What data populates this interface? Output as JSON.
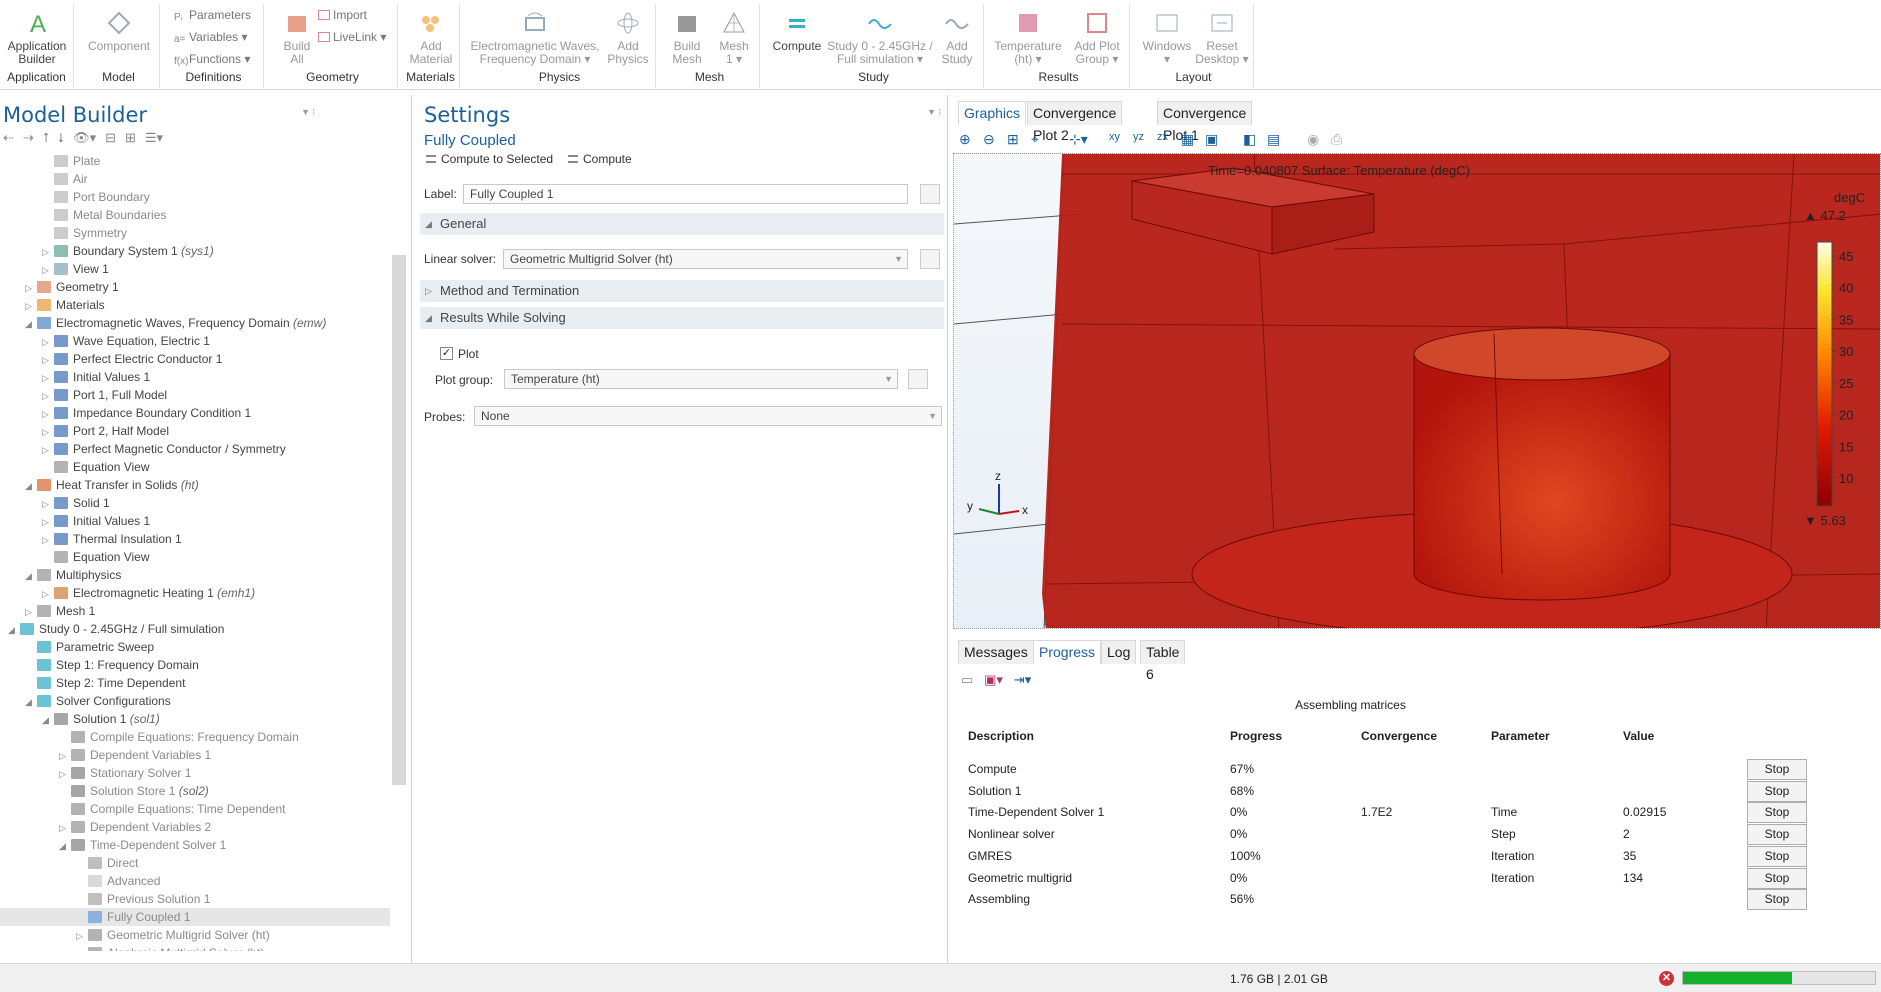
{
  "ribbon": {
    "groups": [
      {
        "label": "Application",
        "buttons": [
          {
            "label": "Application\nBuilder",
            "icon": "app-builder-icon"
          }
        ]
      },
      {
        "label": "Model",
        "buttons": [
          {
            "label": "Component",
            "icon": "component-icon"
          }
        ]
      },
      {
        "label": "Definitions",
        "small": [
          "Parameters",
          "Variables ▾",
          "Functions ▾"
        ]
      },
      {
        "label": "Geometry",
        "buttons": [
          {
            "label": "Build\nAll",
            "icon": "build-all-icon"
          }
        ],
        "small": [
          "Import",
          "LiveLink ▾"
        ]
      },
      {
        "label": "Materials",
        "buttons": [
          {
            "label": "Add\nMaterial",
            "icon": "add-material-icon"
          }
        ]
      },
      {
        "label": "Physics",
        "buttons": [
          {
            "label": "Electromagnetic Waves,\nFrequency Domain ▾",
            "icon": "emw-icon"
          },
          {
            "label": "Add\nPhysics",
            "icon": "add-physics-icon"
          }
        ]
      },
      {
        "label": "Mesh",
        "buttons": [
          {
            "label": "Build\nMesh",
            "icon": "build-mesh-icon"
          },
          {
            "label": "Mesh\n1 ▾",
            "icon": "mesh-icon"
          }
        ]
      },
      {
        "label": "Study",
        "buttons": [
          {
            "label": "Compute",
            "icon": "compute-icon"
          },
          {
            "label": "Study 0 - 2.45GHz /\nFull simulation ▾",
            "icon": "study-icon"
          },
          {
            "label": "Add\nStudy",
            "icon": "add-study-icon"
          }
        ]
      },
      {
        "label": "Results",
        "buttons": [
          {
            "label": "Temperature\n(ht) ▾",
            "icon": "temperature-plot-icon"
          },
          {
            "label": "Add Plot\nGroup ▾",
            "icon": "add-plot-group-icon"
          }
        ]
      },
      {
        "label": "Layout",
        "buttons": [
          {
            "label": "Windows\n▾",
            "icon": "windows-icon"
          },
          {
            "label": "Reset\nDesktop ▾",
            "icon": "reset-desktop-icon"
          }
        ]
      }
    ]
  },
  "model_builder": {
    "title": "Model Builder",
    "tree": [
      {
        "label": "Plate",
        "tag": "",
        "indent": 3,
        "exp": "",
        "icon": "boundary-icon"
      },
      {
        "label": "Air",
        "tag": "",
        "indent": 3,
        "exp": "",
        "icon": "boundary-icon"
      },
      {
        "label": "Port Boundary",
        "tag": "",
        "indent": 3,
        "exp": "",
        "icon": "boundary-icon"
      },
      {
        "label": "Metal Boundaries",
        "tag": "",
        "indent": 3,
        "exp": "",
        "icon": "boundary-icon"
      },
      {
        "label": "Symmetry",
        "tag": "",
        "indent": 3,
        "exp": "",
        "icon": "boundary-icon"
      },
      {
        "label": "Boundary System 1 ",
        "tag": "(sys1)",
        "indent": 3,
        "exp": "▷",
        "icon": "coordinate-system-icon"
      },
      {
        "label": "View 1",
        "tag": "",
        "indent": 3,
        "exp": "▷",
        "icon": "view-icon"
      },
      {
        "label": "Geometry 1",
        "tag": "",
        "indent": 2,
        "exp": "▷",
        "icon": "geometry-icon"
      },
      {
        "label": "Materials",
        "tag": "",
        "indent": 2,
        "exp": "▷",
        "icon": "materials-icon"
      },
      {
        "label": "Electromagnetic Waves, Frequency Domain ",
        "tag": "(emw)",
        "indent": 2,
        "exp": "◢",
        "icon": "emw-physics-icon"
      },
      {
        "label": "Wave Equation, Electric 1",
        "tag": "",
        "indent": 3,
        "exp": "▷",
        "icon": "domain-feature-icon"
      },
      {
        "label": "Perfect Electric Conductor 1",
        "tag": "",
        "indent": 3,
        "exp": "▷",
        "icon": "boundary-feature-icon"
      },
      {
        "label": "Initial Values 1",
        "tag": "",
        "indent": 3,
        "exp": "▷",
        "icon": "domain-feature-icon"
      },
      {
        "label": "Port 1, Full Model",
        "tag": "",
        "indent": 3,
        "exp": "▷",
        "icon": "boundary-feature-icon"
      },
      {
        "label": "Impedance Boundary Condition 1",
        "tag": "",
        "indent": 3,
        "exp": "▷",
        "icon": "boundary-feature-icon"
      },
      {
        "label": "Port 2, Half Model",
        "tag": "",
        "indent": 3,
        "exp": "▷",
        "icon": "boundary-feature-icon"
      },
      {
        "label": "Perfect Magnetic Conductor / Symmetry",
        "tag": "",
        "indent": 3,
        "exp": "▷",
        "icon": "boundary-feature-icon"
      },
      {
        "label": "Equation View",
        "tag": "",
        "indent": 3,
        "exp": "",
        "icon": "equation-view-icon"
      },
      {
        "label": "Heat Transfer in Solids ",
        "tag": "(ht)",
        "indent": 2,
        "exp": "◢",
        "icon": "heat-transfer-icon"
      },
      {
        "label": "Solid 1",
        "tag": "",
        "indent": 3,
        "exp": "▷",
        "icon": "domain-feature-icon"
      },
      {
        "label": "Initial Values 1",
        "tag": "",
        "indent": 3,
        "exp": "▷",
        "icon": "domain-feature-icon"
      },
      {
        "label": "Thermal Insulation 1",
        "tag": "",
        "indent": 3,
        "exp": "▷",
        "icon": "boundary-feature-icon"
      },
      {
        "label": "Equation View",
        "tag": "",
        "indent": 3,
        "exp": "",
        "icon": "equation-view-icon"
      },
      {
        "label": "Multiphysics",
        "tag": "",
        "indent": 2,
        "exp": "◢",
        "icon": "multiphysics-icon"
      },
      {
        "label": "Electromagnetic Heating 1 ",
        "tag": "(emh1)",
        "indent": 3,
        "exp": "▷",
        "icon": "coupling-icon"
      },
      {
        "label": "Mesh 1",
        "tag": "",
        "indent": 2,
        "exp": "▷",
        "icon": "mesh-node-icon"
      },
      {
        "label": "Study 0 - 2.45GHz / Full simulation",
        "tag": "",
        "indent": 1,
        "exp": "◢",
        "icon": "study-node-icon"
      },
      {
        "label": "Parametric Sweep",
        "tag": "",
        "indent": 2,
        "exp": "",
        "icon": "sweep-icon"
      },
      {
        "label": "Step 1: Frequency Domain",
        "tag": "",
        "indent": 2,
        "exp": "",
        "icon": "step-icon"
      },
      {
        "label": "Step 2: Time Dependent",
        "tag": "",
        "indent": 2,
        "exp": "",
        "icon": "step-icon"
      },
      {
        "label": "Solver Configurations",
        "tag": "",
        "indent": 2,
        "exp": "◢",
        "icon": "solver-config-icon"
      },
      {
        "label": "Solution 1 ",
        "tag": "(sol1)",
        "indent": 3,
        "exp": "◢",
        "icon": "solution-icon"
      },
      {
        "label": "Compile Equations: Frequency Domain",
        "tag": "",
        "indent": 4,
        "exp": "",
        "icon": "compile-icon"
      },
      {
        "label": "Dependent Variables 1",
        "tag": "",
        "indent": 4,
        "exp": "▷",
        "icon": "variables-icon"
      },
      {
        "label": "Stationary Solver 1",
        "tag": "",
        "indent": 4,
        "exp": "▷",
        "icon": "solver-icon"
      },
      {
        "label": "Solution Store 1 ",
        "tag": "(sol2)",
        "indent": 4,
        "exp": "",
        "icon": "solution-store-icon"
      },
      {
        "label": "Compile Equations: Time Dependent",
        "tag": "",
        "indent": 4,
        "exp": "",
        "icon": "compile-icon"
      },
      {
        "label": "Dependent Variables 2",
        "tag": "",
        "indent": 4,
        "exp": "▷",
        "icon": "variables-icon"
      },
      {
        "label": "Time-Dependent Solver 1",
        "tag": "",
        "indent": 4,
        "exp": "◢",
        "icon": "solver-icon"
      },
      {
        "label": "Direct",
        "tag": "",
        "indent": 5,
        "exp": "",
        "icon": "direct-icon"
      },
      {
        "label": "Advanced",
        "tag": "",
        "indent": 5,
        "exp": "",
        "icon": "advanced-icon"
      },
      {
        "label": "Previous Solution 1",
        "tag": "",
        "indent": 5,
        "exp": "",
        "icon": "previous-solution-icon"
      },
      {
        "label": "Fully Coupled 1",
        "tag": "",
        "indent": 5,
        "exp": "",
        "icon": "fully-coupled-icon",
        "selected": true
      },
      {
        "label": "Geometric Multigrid Solver (ht)",
        "tag": "",
        "indent": 5,
        "exp": "▷",
        "icon": "multigrid-icon"
      },
      {
        "label": "Algebraic Multigrid Solver (ht)",
        "tag": "",
        "indent": 5,
        "exp": "▷",
        "icon": "multigrid-icon"
      }
    ]
  },
  "settings": {
    "title": "Settings",
    "subtitle": "Fully Coupled",
    "compute_to_selected": "Compute to Selected",
    "compute": "Compute",
    "label_label": "Label:",
    "label_value": "Fully Coupled 1",
    "section_general": "General",
    "linear_solver_label": "Linear solver:",
    "linear_solver_value": "Geometric Multigrid Solver (ht)",
    "section_method": "Method and Termination",
    "section_results": "Results While Solving",
    "plot_label": "Plot",
    "plot_checked": true,
    "plot_group_label": "Plot group:",
    "plot_group_value": "Temperature (ht)",
    "probes_label": "Probes:",
    "probes_value": "None"
  },
  "graphics": {
    "tabs": [
      "Graphics",
      "Convergence Plot 2",
      "Convergence Plot 1"
    ],
    "active_tab": 0,
    "plot_title": "Time=0.040807   Surface: Temperature (degC)",
    "unit": "degC",
    "max_label": "▲ 47.2",
    "min_label": "▼ 5.63",
    "ticks": [
      "45",
      "40",
      "35",
      "30",
      "25",
      "20",
      "15",
      "10"
    ],
    "axis_z": "z",
    "axis_y": "y",
    "axis_x": "x"
  },
  "progress": {
    "tabs": [
      "Messages",
      "Progress",
      "Log",
      "Table 6"
    ],
    "active_tab": 1,
    "status": "Assembling matrices",
    "headers": [
      "Description",
      "Progress",
      "Convergence",
      "Parameter",
      "Value"
    ],
    "rows": [
      {
        "description": "Compute",
        "progress": "67%",
        "convergence": "",
        "parameter": "",
        "value": "",
        "stop": "Stop"
      },
      {
        "description": "Solution 1",
        "progress": "68%",
        "convergence": "",
        "parameter": "",
        "value": "",
        "stop": "Stop"
      },
      {
        "description": "Time-Dependent Solver 1",
        "progress": "0%",
        "convergence": "1.7E2",
        "parameter": "Time",
        "value": "0.02915",
        "stop": "Stop"
      },
      {
        "description": "Nonlinear solver",
        "progress": "0%",
        "convergence": "",
        "parameter": "Step",
        "value": "2",
        "stop": "Stop"
      },
      {
        "description": "GMRES",
        "progress": "100%",
        "convergence": "",
        "parameter": "Iteration",
        "value": "35",
        "stop": "Stop"
      },
      {
        "description": "Geometric multigrid",
        "progress": "0%",
        "convergence": "",
        "parameter": "Iteration",
        "value": "134",
        "stop": "Stop"
      },
      {
        "description": "Assembling",
        "progress": "56%",
        "convergence": "",
        "parameter": "",
        "value": "",
        "stop": "Stop"
      }
    ]
  },
  "statusbar": {
    "memory": "1.76 GB | 2.01 GB",
    "progress_fraction": 0.57
  },
  "colors": {
    "accent": "#1b5f9e",
    "progress_green": "#12b02b",
    "error_red": "#d0303c"
  }
}
